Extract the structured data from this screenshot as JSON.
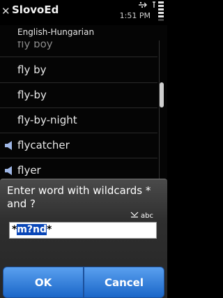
{
  "app": {
    "title": "SlovoEd",
    "clock": "1:51 PM"
  },
  "dictionary": {
    "name": "English-Hungarian"
  },
  "list": {
    "items": [
      {
        "word": "fly boy",
        "audio": false,
        "faded": true
      },
      {
        "word": "fly by",
        "audio": false,
        "faded": false
      },
      {
        "word": "fly-by",
        "audio": false,
        "faded": false
      },
      {
        "word": "fly-by-night",
        "audio": false,
        "faded": false
      },
      {
        "word": "flycatcher",
        "audio": true,
        "faded": false
      },
      {
        "word": "flyer",
        "audio": true,
        "faded": false
      },
      {
        "word": "",
        "audio": false,
        "faded": true
      }
    ]
  },
  "dialog": {
    "prompt": "Enter word with wildcards * and ?",
    "input_mode": "abc",
    "input_prefix": "*",
    "input_selected": "m?nd",
    "input_suffix": "*",
    "ok_label": "OK",
    "cancel_label": "Cancel"
  },
  "icons": {
    "close": "close-icon",
    "usb": "usb-icon",
    "battery": "battery-icon",
    "speaker": "speaker-icon",
    "pen": "pen-icon"
  },
  "colors": {
    "button": "#2f7fdc",
    "selection": "#0a47b8"
  }
}
